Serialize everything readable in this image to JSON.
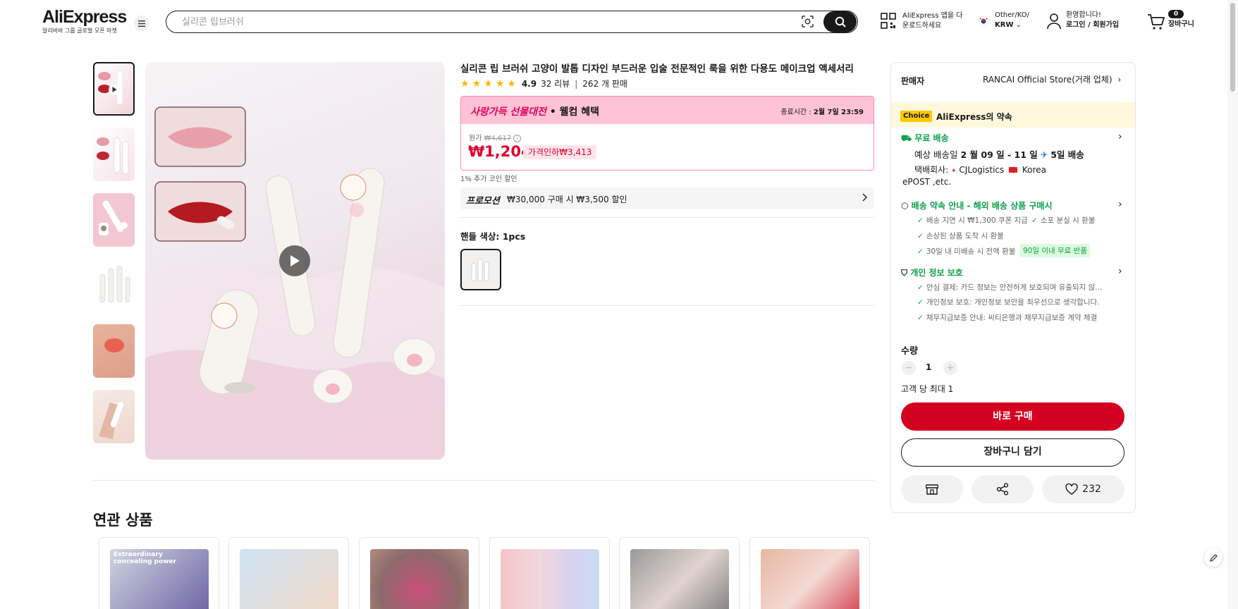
{
  "header": {
    "logo": "AliExpress",
    "logo_sub": "알리바바 그룹 글로벌 오픈 마켓",
    "search_placeholder": "실리콘 립브러쉬",
    "app_download_line1": "AliExpress 앱을 다",
    "app_download_line2": "운로드하세요",
    "region_line1": "Other/KO/",
    "region_line2": "KRW",
    "account_line1": "환영합니다!",
    "account_line2": "로그인 / 회원가입",
    "cart_count": "0",
    "cart_label": "장바구니"
  },
  "product": {
    "title": "실리콘 립 브러쉬 고양이 발톱 디자인 부드러운 입술 전문적인 룩을 위한 다용도 메이크업 액세서리",
    "rating": "4.9",
    "reviews": "32 리뷰",
    "divider": "|",
    "sold": "262 개 판매",
    "promo_title_pink": "사랑가득 선물대전",
    "promo_title_rest": "• 웰컴 혜택",
    "promo_end_label": "종료시간 :",
    "promo_end_time": "2월 7일 23:59",
    "original_label": "원가",
    "original_price": "₩4,617",
    "price": "₩1,204",
    "price_cut": "가격인하₩3,413",
    "coin_discount": "1% 추가 코인 할인",
    "promotion_label": "프로모션",
    "promotion_text": "₩30,000 구매 시 ₩3,500 할인",
    "color_label": "핸들 색상:",
    "color_value": "1pcs"
  },
  "seller": {
    "label": "판매자",
    "store": "RANCAI Official Store",
    "store_suffix": "(거래 업체)",
    "choice_tag": "Choice",
    "choice_text": "AliExpress의 약속",
    "free_shipping": "무료 배송",
    "delivery_prefix": "예상 배송일",
    "delivery_dates": "2 월 09 일 - 11 일",
    "delivery_fast": "5일 배송",
    "carrier_label": "택배회사:",
    "carrier1": "CJLogistics",
    "carrier2": "Korea",
    "carrier3": "ePOST ,etc.",
    "guarantee_title": "배송 약속 안내 - 해외 배송 상품 구매시",
    "guarantee_items": [
      "배송 지연 시 ₩1,300 쿠폰 지급",
      "소포 분실 시 환불",
      "손상된 상품 도착 시 환불",
      "30일 내 미배송 시 전액 환불"
    ],
    "guarantee_badge": "90일 이내 무료 반품",
    "privacy_title": "개인 정보 보호",
    "privacy_items": [
      "안심 결제: 카드 정보는 안전하게 보호되며 유출되지 않...",
      "개인정보 보호: 개인정보 보안을 최우선으로 생각합니다.",
      "채무지급보증 안내: 씨티은행과 채무지급보증 계약 체결"
    ],
    "qty_label": "수량",
    "qty_value": "1",
    "qty_limit": "고객 당 최대 1",
    "buy_now": "바로 구매",
    "add_cart": "장바구니 담기",
    "wishlist_count": "232"
  },
  "related": {
    "title": "연관 상품",
    "card1_text": "Extraordinary concealing power"
  },
  "colors": {
    "accent_red": "#d4001f",
    "price_red": "#e0002c",
    "green": "#0d9f4c",
    "promo_pink": "#ffc2d6",
    "choice_yellow": "#ffc800"
  }
}
